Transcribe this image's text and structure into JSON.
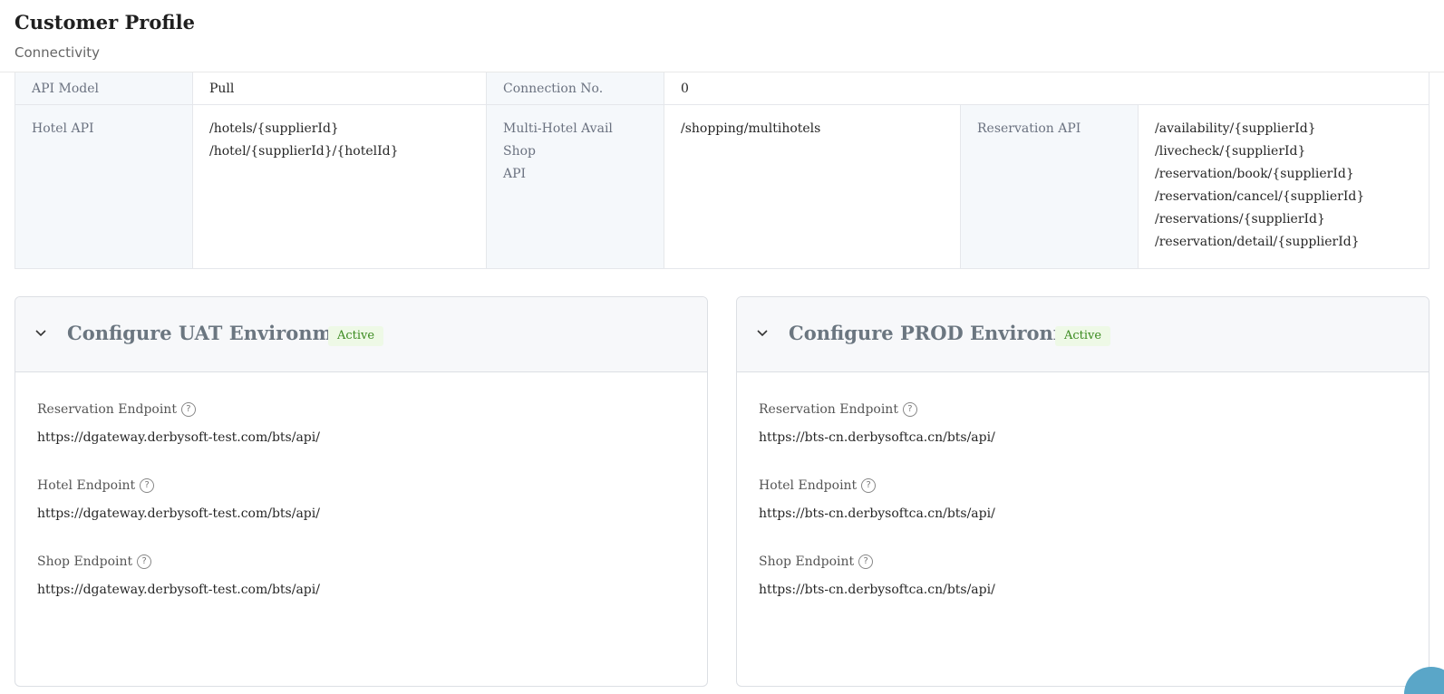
{
  "header": {
    "title": "Customer Profile",
    "subtitle": "Connectivity"
  },
  "table": {
    "api_model_label": "API Model",
    "api_model_value": "Pull",
    "connection_label": "Connection No.",
    "connection_value": "0",
    "hotel_api_label": "Hotel API",
    "hotel_api_values": [
      "/hotels/{supplierId}",
      "/hotel/{supplierId}/{hotelId}"
    ],
    "multi_hotel_label_line1": "Multi-Hotel Avail Shop",
    "multi_hotel_label_line2": "API",
    "multi_hotel_value": "/shopping/multihotels",
    "reservation_api_label": "Reservation API",
    "reservation_api_values": [
      "/availability/{supplierId}",
      "/livecheck/{supplierId}",
      "/reservation/book/{supplierId}",
      "/reservation/cancel/{supplierId}",
      "/reservations/{supplierId}",
      "/reservation/detail/{supplierId}"
    ]
  },
  "uat": {
    "title": "Configure UAT Environment",
    "status": "Active",
    "reservation_label": "Reservation Endpoint",
    "reservation_value": "https://dgateway.derbysoft-test.com/bts/api/",
    "hotel_label": "Hotel Endpoint",
    "hotel_value": "https://dgateway.derbysoft-test.com/bts/api/",
    "shop_label": "Shop Endpoint",
    "shop_value": "https://dgateway.derbysoft-test.com/bts/api/"
  },
  "prod": {
    "title": "Configure PROD Environment",
    "status": "Active",
    "reservation_label": "Reservation Endpoint",
    "reservation_value": "https://bts-cn.derbysoftca.cn/bts/api/",
    "hotel_label": "Hotel Endpoint",
    "hotel_value": "https://bts-cn.derbysoftca.cn/bts/api/",
    "shop_label": "Shop Endpoint",
    "shop_value": "https://bts-cn.derbysoftca.cn/bts/api/"
  },
  "icons": {
    "help": "question-circle-icon",
    "collapse": "chevron-down-icon"
  },
  "colors": {
    "active_badge_text": "#3a8a1f",
    "active_badge_bg": "#eef9e6",
    "label_bg": "#f5f8fb"
  }
}
